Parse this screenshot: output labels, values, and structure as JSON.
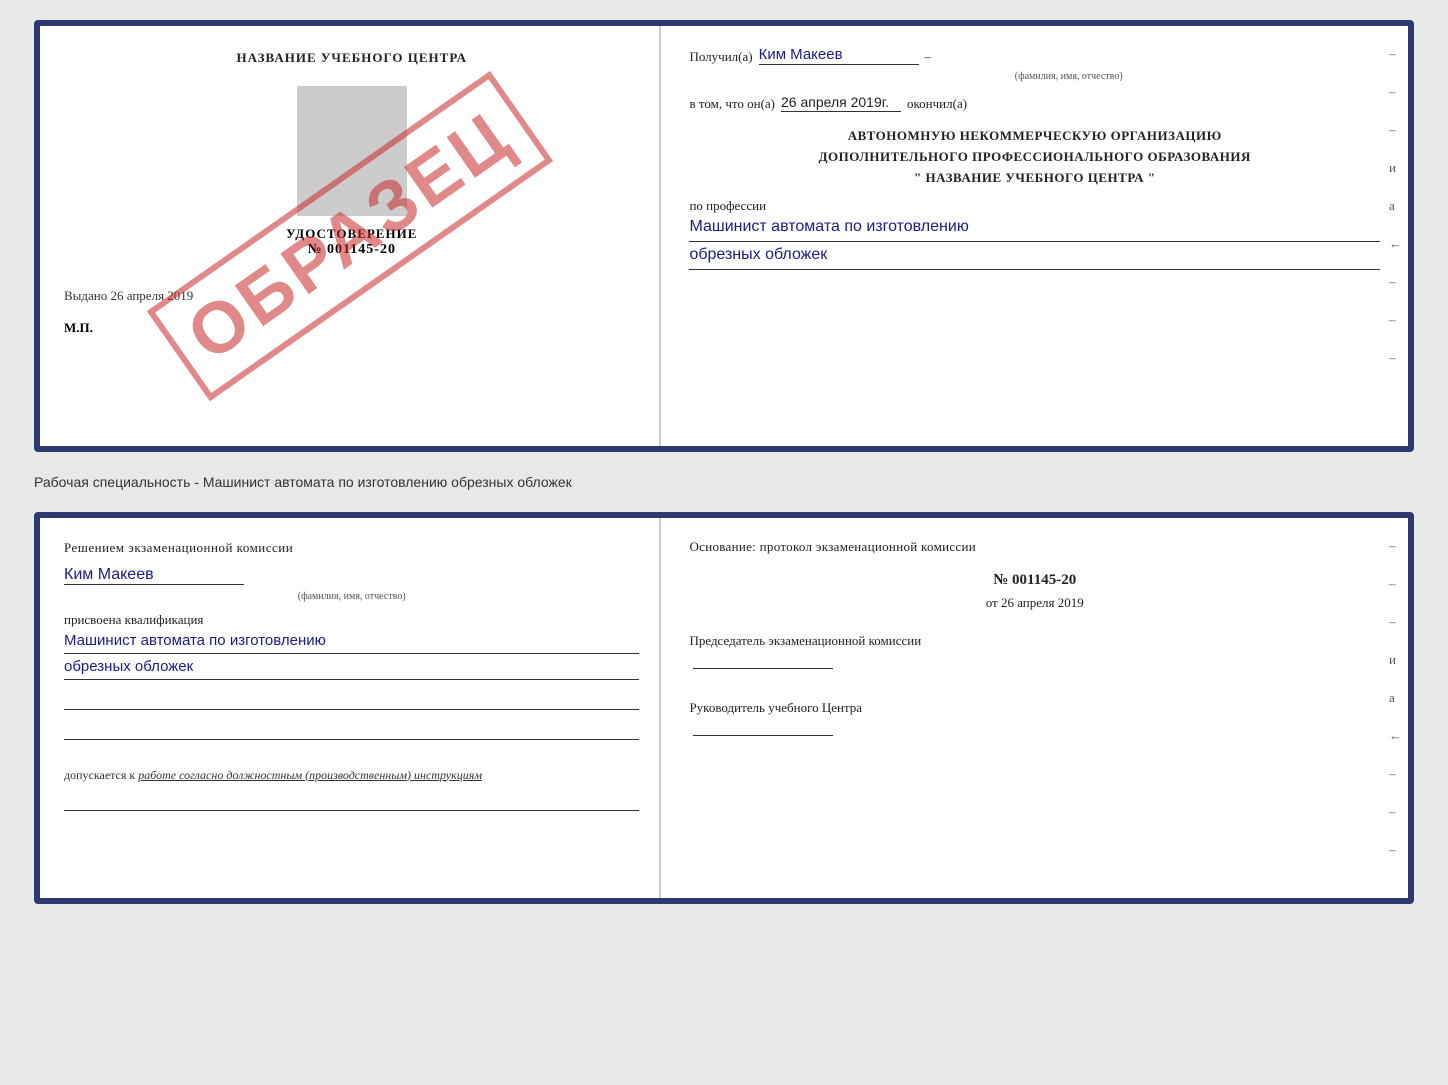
{
  "doc1": {
    "left": {
      "title": "НАЗВАНИЕ УЧЕБНОГО ЦЕНТРА",
      "udostoverenie_label": "УДОСТОВЕРЕНИЕ",
      "number": "№ 001145-20",
      "vydano_label": "Выдано",
      "vydano_date": "26 апреля 2019",
      "mp_label": "М.П.",
      "watermark": "ОБРАЗЕЦ"
    },
    "right": {
      "poluchil_label": "Получил(а)",
      "fio_value": "Ким Макеев",
      "fio_sublabel": "(фамилия, имя, отчество)",
      "vtom_label": "в том, что он(а)",
      "date_value": "26 апреля 2019г.",
      "okonchil_label": "окончил(а)",
      "org_line1": "АВТОНОМНУЮ НЕКОММЕРЧЕСКУЮ ОРГАНИЗАЦИЮ",
      "org_line2": "ДОПОЛНИТЕЛЬНОГО ПРОФЕССИОНАЛЬНОГО ОБРАЗОВАНИЯ",
      "org_quote_open": "\"",
      "org_name": "НАЗВАНИЕ УЧЕБНОГО ЦЕНТРА",
      "org_quote_close": "\"",
      "po_professii_label": "по профессии",
      "profession_line1": "Машинист автомата по изготовлению",
      "profession_line2": "обрезных обложек",
      "dashes": [
        "-",
        "-",
        "-",
        "и",
        "а",
        "←",
        "-",
        "-",
        "-",
        "-"
      ]
    }
  },
  "separator": {
    "text": "Рабочая специальность - Машинист автомата по изготовлению обрезных обложек"
  },
  "doc2": {
    "left": {
      "komissia_title": "Решением экзаменационной комиссии",
      "fio_value": "Ким Макеев",
      "fio_sublabel": "(фамилия, имя, отчество)",
      "prisvoena_label": "присвоена квалификация",
      "kvalif_line1": "Машинист автомата по изготовлению",
      "kvalif_line2": "обрезных обложек",
      "dopusk_label": "допускается к",
      "dopusk_value": "работе согласно должностным (производственным) инструкциям"
    },
    "right": {
      "osnov_title": "Основание: протокол экзаменационной комиссии",
      "protokol_prefix": "№",
      "protokol_num": "001145-20",
      "ot_prefix": "от",
      "protokol_date": "26 апреля 2019",
      "pred_komissia_label": "Председатель экзаменационной комиссии",
      "ruk_label": "Руководитель учебного Центра",
      "dashes": [
        "-",
        "-",
        "-",
        "и",
        "а",
        "←",
        "-",
        "-",
        "-",
        "-"
      ]
    }
  }
}
